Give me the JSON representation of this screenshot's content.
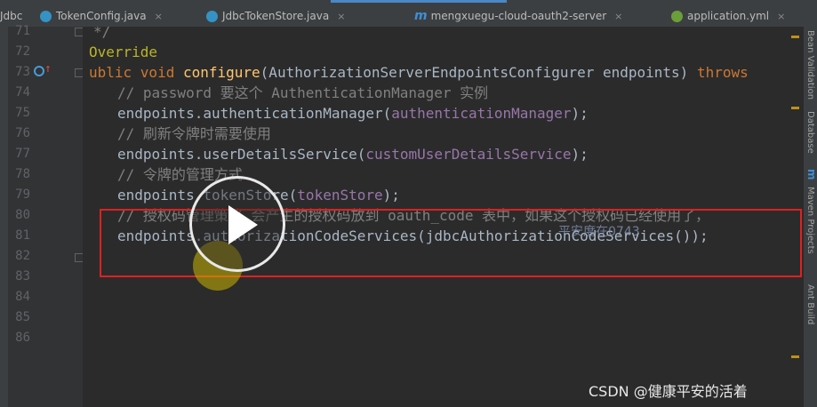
{
  "tabs": [
    {
      "label": "Jdbc",
      "icon": "none",
      "close": ""
    },
    {
      "label": "TokenConfig.java",
      "icon": "java-class-icon",
      "close": "×"
    },
    {
      "label": "JdbcTokenStore.java",
      "icon": "java-class-icon",
      "close": "×"
    },
    {
      "label": "mengxuegu-cloud-oauth2-server",
      "icon": "maven-module-icon",
      "close": "×"
    },
    {
      "label": "application.yml",
      "icon": "spring-config-icon",
      "close": "×"
    }
  ],
  "line_numbers": [
    "71",
    "72",
    "73",
    "74",
    "75",
    "76",
    "77",
    "78",
    "79",
    "80",
    "81",
    "82",
    "83",
    "84",
    "85",
    "86"
  ],
  "code": {
    "l71": "*/",
    "l72": "Override",
    "l73": {
      "kw1": "ublic ",
      "kw2": "void ",
      "fn": "configure",
      "rest": "(AuthorizationServerEndpointsConfigurer endpoints) ",
      "kw3": "throws"
    },
    "l74": "// password 要这个 AuthenticationManager 实例",
    "l75": {
      "pre": "endpoints.authenticationManager(",
      "fld": "authenticationManager",
      "post": ");"
    },
    "l76": "// 刷新令牌时需要使用",
    "l77": {
      "pre": "endpoints.userDetailsService(",
      "fld": "customUserDetailsService",
      "post": ");"
    },
    "l78": "// 令牌的管理方式",
    "l79": {
      "pre": "endpoints.tokenStore(",
      "fld": "tokenStore",
      "post": ");"
    },
    "l80": "// 授权码管理策略 会产生的授权码放到 oauth_code 表中，如果这个授权码已经使用了，",
    "l81": "endpoints.authorizationCodeServices(jdbcAuthorizationCodeServices());"
  },
  "right_panel": [
    "Bean Validation",
    "Database",
    "m",
    "Maven Projects",
    "Ant Build"
  ],
  "overlay": {
    "watermark_center": "平安度在0743",
    "watermark": "CSDN @健康平安的活着"
  },
  "colors": {
    "selection": "#214283",
    "highlight_box": "#e02020",
    "keyword": "#cc7832",
    "method": "#ffc66d",
    "field": "#9876aa",
    "comment": "#808080"
  }
}
